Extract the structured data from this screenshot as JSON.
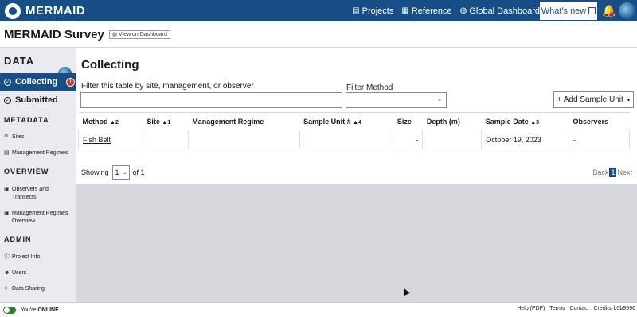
{
  "topbar": {
    "logo": "MERMAID",
    "nav": [
      {
        "label": "Projects",
        "icon": "projects-icon"
      },
      {
        "label": "Reference",
        "icon": "reference-icon"
      },
      {
        "label": "Global Dashboard",
        "icon": "globe-icon"
      }
    ],
    "whats_new": "What's new"
  },
  "survey": {
    "title": "MERMAID Survey",
    "dashboard_button": "View on Dashboard"
  },
  "sidebar": {
    "data_title": "DATA",
    "collecting": "Collecting",
    "collecting_badge": "1",
    "submitted": "Submitted",
    "metadata_title": "METADATA",
    "metadata_items": [
      "Sites",
      "Management Regimes"
    ],
    "overview_title": "OVERVIEW",
    "overview_items": [
      "Observers and Transects",
      "Management Regimes Overview"
    ],
    "admin_title": "ADMIN",
    "admin_items": [
      "Project Info",
      "Users",
      "Data Sharing"
    ]
  },
  "main": {
    "heading": "Collecting",
    "filter_label": "Filter this table by site, management, or observer",
    "filter_value": "",
    "method_label": "Filter Method",
    "method_value": "",
    "add_button": "+ Add Sample Unit",
    "columns": [
      {
        "label": "Method",
        "sort": "▲2"
      },
      {
        "label": "Site",
        "sort": "▲1"
      },
      {
        "label": "Management Regime",
        "sort": ""
      },
      {
        "label": "Sample Unit #",
        "sort": "▲4"
      },
      {
        "label": "Size",
        "sort": ""
      },
      {
        "label": "Depth (m)",
        "sort": ""
      },
      {
        "label": "Sample Date",
        "sort": "▲3"
      },
      {
        "label": "Observers",
        "sort": ""
      }
    ],
    "rows": [
      {
        "method": "Fish Belt",
        "site": "",
        "management": "",
        "sample_unit": "",
        "size": "-",
        "depth": "",
        "date": "October 19, 2023",
        "observers": "-"
      }
    ],
    "showing_label": "Showing",
    "page_value": "1",
    "of_label": "of 1",
    "pager": {
      "back": "Back",
      "current": "1",
      "next": "Next"
    }
  },
  "footer": {
    "status_prefix": "You're",
    "status": "ONLINE",
    "links": [
      "Help (PDF)",
      "Terms",
      "Contact",
      "Credits"
    ],
    "hash": "b5b9596"
  },
  "colors": {
    "brand": "#174e86",
    "badge": "#d32f2f",
    "online": "#2e7d32"
  }
}
